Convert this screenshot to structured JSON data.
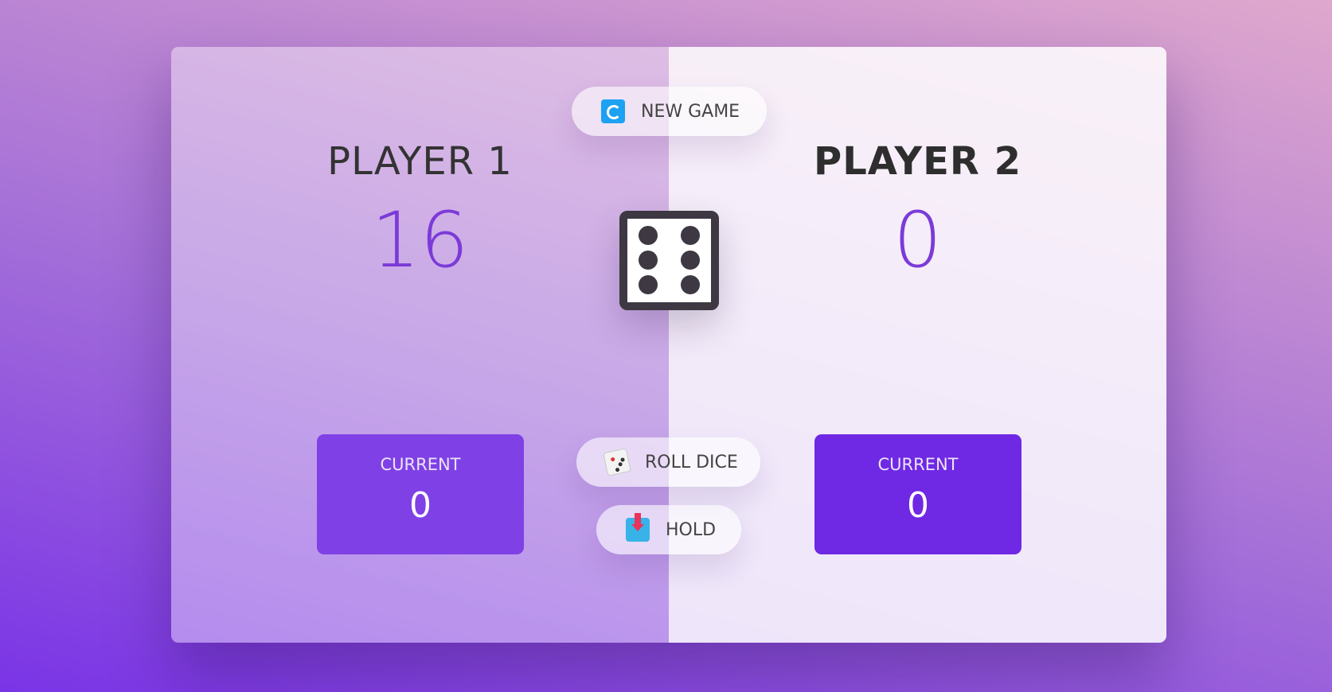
{
  "players": [
    {
      "name": "PLAYER 1",
      "score": "16",
      "current_label": "CURRENT",
      "current_score": "0",
      "active": true
    },
    {
      "name": "PLAYER 2",
      "score": "0",
      "current_label": "CURRENT",
      "current_score": "0",
      "active": false
    }
  ],
  "buttons": {
    "new_game": "NEW GAME",
    "roll_dice": "ROLL DICE",
    "hold": "HOLD"
  },
  "dice": {
    "value": 6
  },
  "icons": {
    "new_game": "refresh-icon",
    "roll_dice": "game-die-icon",
    "hold": "inbox-tray-icon"
  },
  "colors": {
    "score": "#7b3ad8",
    "current_active": "#7f41e6",
    "current_inactive": "#6f28e4",
    "dice_border": "#3d3842"
  }
}
